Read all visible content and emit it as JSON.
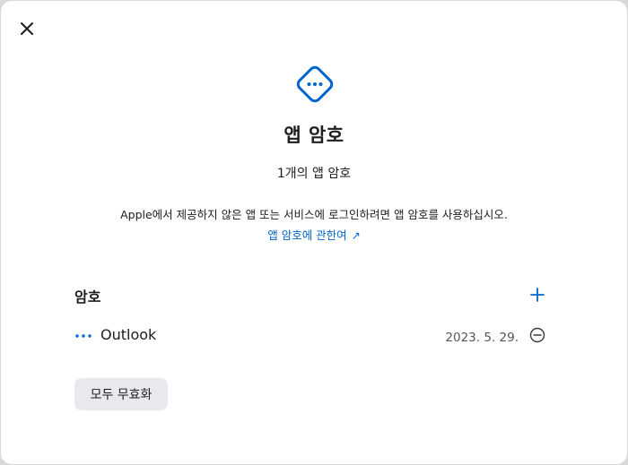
{
  "dialog": {
    "close_icon": "close-icon",
    "header_icon": "app-password-icon",
    "title": "앱 암호",
    "subtitle": "1개의 앱 암호",
    "description": "Apple에서 제공하지 않은 앱 또는 서비스에 로그인하려면 앱 암호를 사용하십시오.",
    "learn_link": "앱 암호에 관한여",
    "learn_link_icon": "external-arrow-icon",
    "accent_color": "#0066cc"
  },
  "passwords": {
    "section_title": "암호",
    "add_icon": "plus-icon",
    "items": [
      {
        "name": "Outlook",
        "date": "2023. 5. 29.",
        "icon": "more-dots-icon",
        "remove_icon": "minus-circle-icon"
      }
    ]
  },
  "actions": {
    "revoke_all_label": "모두 무효화"
  }
}
